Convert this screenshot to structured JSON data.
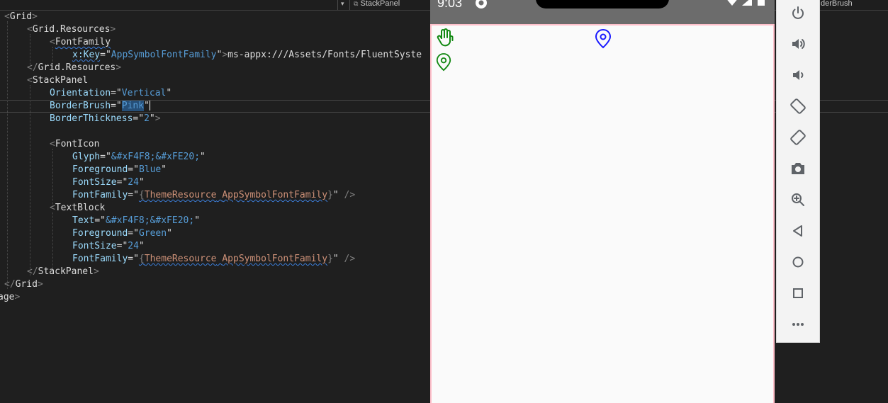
{
  "toolbar": {
    "left_crumb": "StackPanel",
    "right_crumb": "derBrush"
  },
  "code": {
    "l1": {
      "lt": "<",
      "tag": "Grid",
      "gt": ">"
    },
    "l2": {
      "lt": "<",
      "tag": "Grid.Resources",
      "gt": ">"
    },
    "l3": {
      "lt": "<",
      "tag": "FontFamily"
    },
    "l4": {
      "attr": "x:Key",
      "eq": "=\"",
      "val": "AppSymbolFontFamily",
      "q": "\"",
      "gt": ">",
      "text": "ms-appx:///Assets/Fonts/FluentSyste"
    },
    "l5": {
      "lt": "</",
      "tag": "Grid.Resources",
      "gt": ">"
    },
    "l6": {
      "lt": "<",
      "tag": "StackPanel"
    },
    "l7": {
      "attr": "Orientation",
      "eq": "=\"",
      "val": "Vertical",
      "q": "\""
    },
    "l8": {
      "attr": "BorderBrush",
      "eq": "=\"",
      "val": "Pink",
      "q": "\""
    },
    "l9": {
      "attr": "BorderThickness",
      "eq": "=\"",
      "val": "2",
      "q": "\"",
      "gt": ">"
    },
    "l11": {
      "lt": "<",
      "tag": "FontIcon"
    },
    "l12": {
      "attr": "Glyph",
      "eq": "=\"",
      "val": "&#xF4F8;&#xFE20;",
      "q": "\""
    },
    "l13": {
      "attr": "Foreground",
      "eq": "=\"",
      "val": "Blue",
      "q": "\""
    },
    "l14": {
      "attr": "FontSize",
      "eq": "=\"",
      "val": "24",
      "q": "\""
    },
    "l15": {
      "attr": "FontFamily",
      "eq": "=\"",
      "ob": "{",
      "mk": "ThemeResource",
      "sp": " ",
      "ref": "AppSymbolFontFamily",
      "cb": "}",
      "q": "\"",
      "end": " />"
    },
    "l16": {
      "lt": "<",
      "tag": "TextBlock"
    },
    "l17": {
      "attr": "Text",
      "eq": "=\"",
      "val": "&#xF4F8;&#xFE20;",
      "q": "\""
    },
    "l18": {
      "attr": "Foreground",
      "eq": "=\"",
      "val": "Green",
      "q": "\""
    },
    "l19": {
      "attr": "FontSize",
      "eq": "=\"",
      "val": "24",
      "q": "\""
    },
    "l20": {
      "attr": "FontFamily",
      "eq": "=\"",
      "ob": "{",
      "mk": "ThemeResource",
      "sp": " ",
      "ref": "AppSymbolFontFamily",
      "cb": "}",
      "q": "\"",
      "end": " />"
    },
    "l21": {
      "lt": "</",
      "tag": "StackPanel",
      "gt": ">"
    },
    "l22": {
      "lt": "</",
      "tag": "Grid",
      "gt": ">"
    },
    "l23": {
      "frag": "age",
      "gt": ">"
    }
  },
  "emulator": {
    "time": "9:03",
    "app": {
      "stack_border_color": "#ffc0cb",
      "fonticon_color": "#1a1aff",
      "textblock_color": "#118811",
      "hand_icon": "hand-icon",
      "location_icon": "location-pin-icon"
    },
    "side_controls": [
      "power-icon",
      "volume-up-icon",
      "volume-down-icon",
      "rotate-left-icon",
      "rotate-right-icon",
      "camera-icon",
      "zoom-icon",
      "back-icon",
      "home-icon",
      "overview-icon",
      "more-icon"
    ]
  }
}
